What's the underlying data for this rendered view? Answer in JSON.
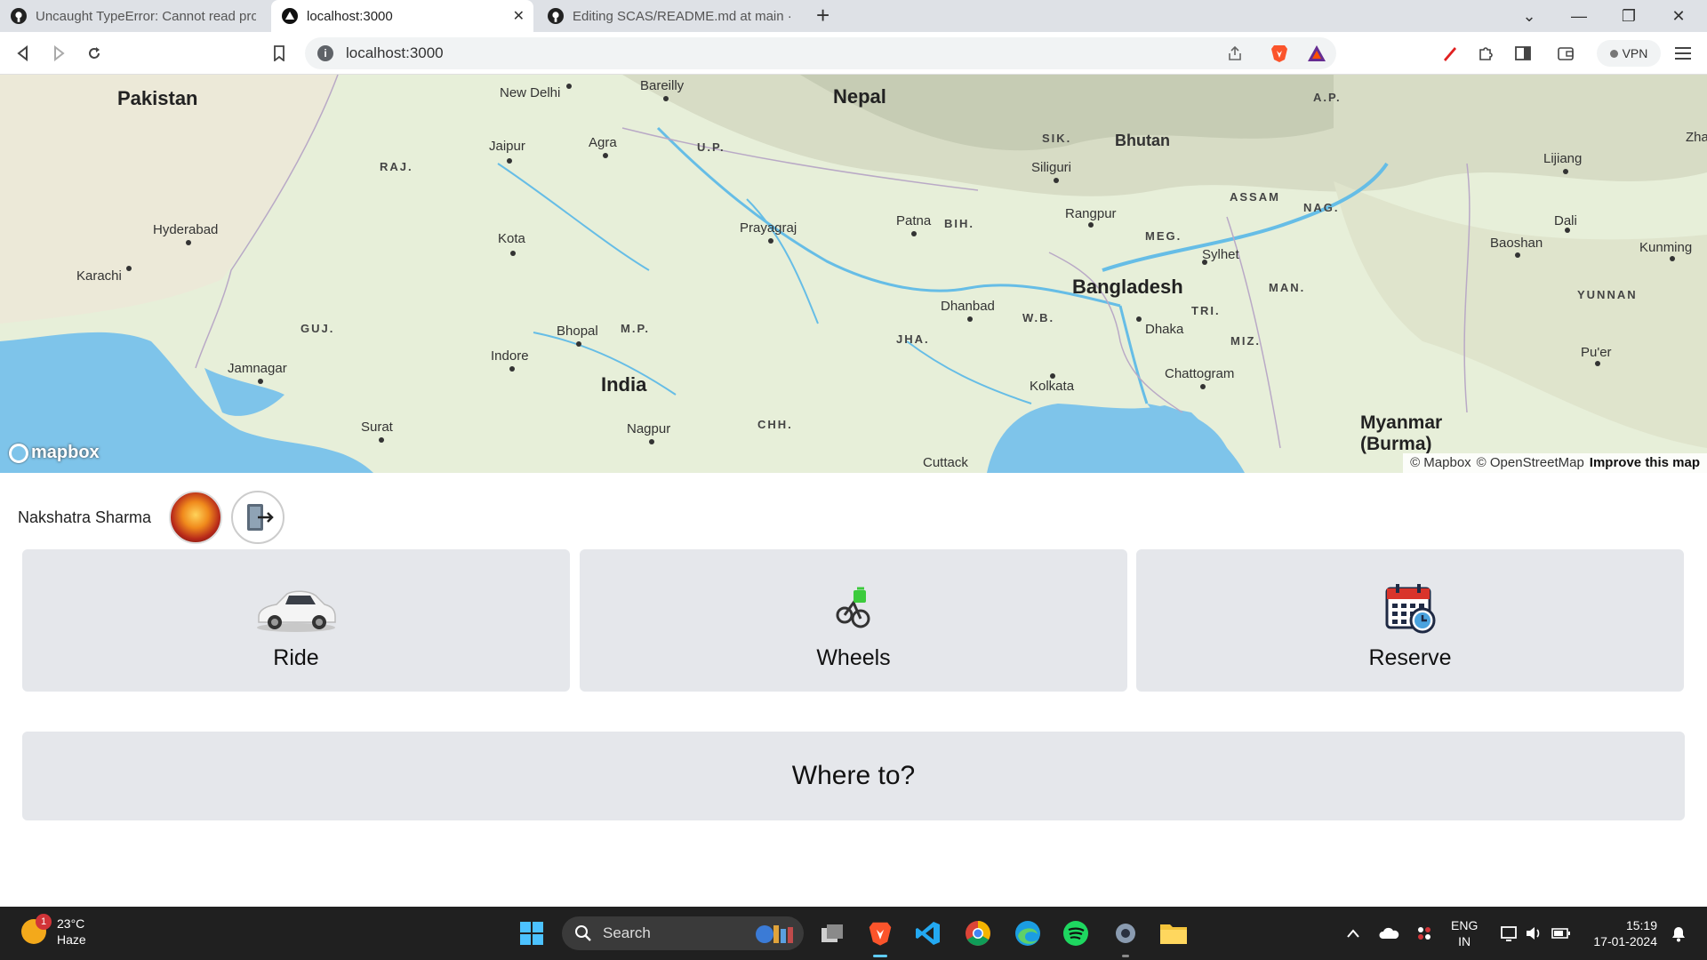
{
  "browser": {
    "tabs": [
      {
        "title": "Uncaught TypeError: Cannot read properties"
      },
      {
        "title": "localhost:3000"
      },
      {
        "title": "Editing SCAS/README.md at main · N"
      }
    ],
    "url": "localhost:3000",
    "vpn_label": "VPN"
  },
  "map": {
    "labels": {
      "pakistan": "Pakistan",
      "new_delhi": "New Delhi",
      "bareilly": "Bareilly",
      "nepal": "Nepal",
      "ap": "A.P.",
      "sik": "SIK.",
      "bhutan": "Bhutan",
      "zha": "Zha",
      "raj": "RAJ.",
      "jaipur": "Jaipur",
      "agra": "Agra",
      "up": "U.P.",
      "siliguri": "Siliguri",
      "lijiang": "Lijiang",
      "assam": "ASSAM",
      "nag": "NAG.",
      "rangpur": "Rangpur",
      "hyderabad": "Hyderabad",
      "kota": "Kota",
      "prayagraj": "Prayagraj",
      "patna": "Patna",
      "bih": "BIH.",
      "meg": "MEG.",
      "dali": "Dali",
      "baoshan": "Baoshan",
      "kunming": "Kunming",
      "karachi": "Karachi",
      "sylhet": "Sylhet",
      "bangladesh": "Bangladesh",
      "man": "MAN.",
      "yunnan": "YUNNAN",
      "guj": "GUJ.",
      "bhopal": "Bhopal",
      "mp": "M.P.",
      "dhanbad": "Dhanbad",
      "wb": "W.B.",
      "tri": "TRI.",
      "dhaka": "Dhaka",
      "jha": "JHA.",
      "miz": "MIZ.",
      "indore": "Indore",
      "puer": "Pu'er",
      "jamnagar": "Jamnagar",
      "chattogram": "Chattogram",
      "india": "India",
      "kolkata": "Kolkata",
      "chh": "CHH.",
      "surat": "Surat",
      "myanmar": "Myanmar (Burma)",
      "nagpur": "Nagpur",
      "cuttack": "Cuttack"
    },
    "logo": "mapbox",
    "attribution": {
      "mapbox": "© Mapbox",
      "osm": "© OpenStreetMap",
      "improve": "Improve this map"
    }
  },
  "user": {
    "name": "Nakshatra Sharma"
  },
  "options": [
    {
      "label": "Ride",
      "icon": "car-icon"
    },
    {
      "label": "Wheels",
      "icon": "bicycle-icon"
    },
    {
      "label": "Reserve",
      "icon": "calendar-clock-icon"
    }
  ],
  "where_to": "Where to?",
  "taskbar": {
    "weather_temp": "23°C",
    "weather_desc": "Haze",
    "weather_badge": "1",
    "search_placeholder": "Search",
    "lang_1": "ENG",
    "lang_2": "IN",
    "time": "15:19",
    "date": "17-01-2024"
  }
}
